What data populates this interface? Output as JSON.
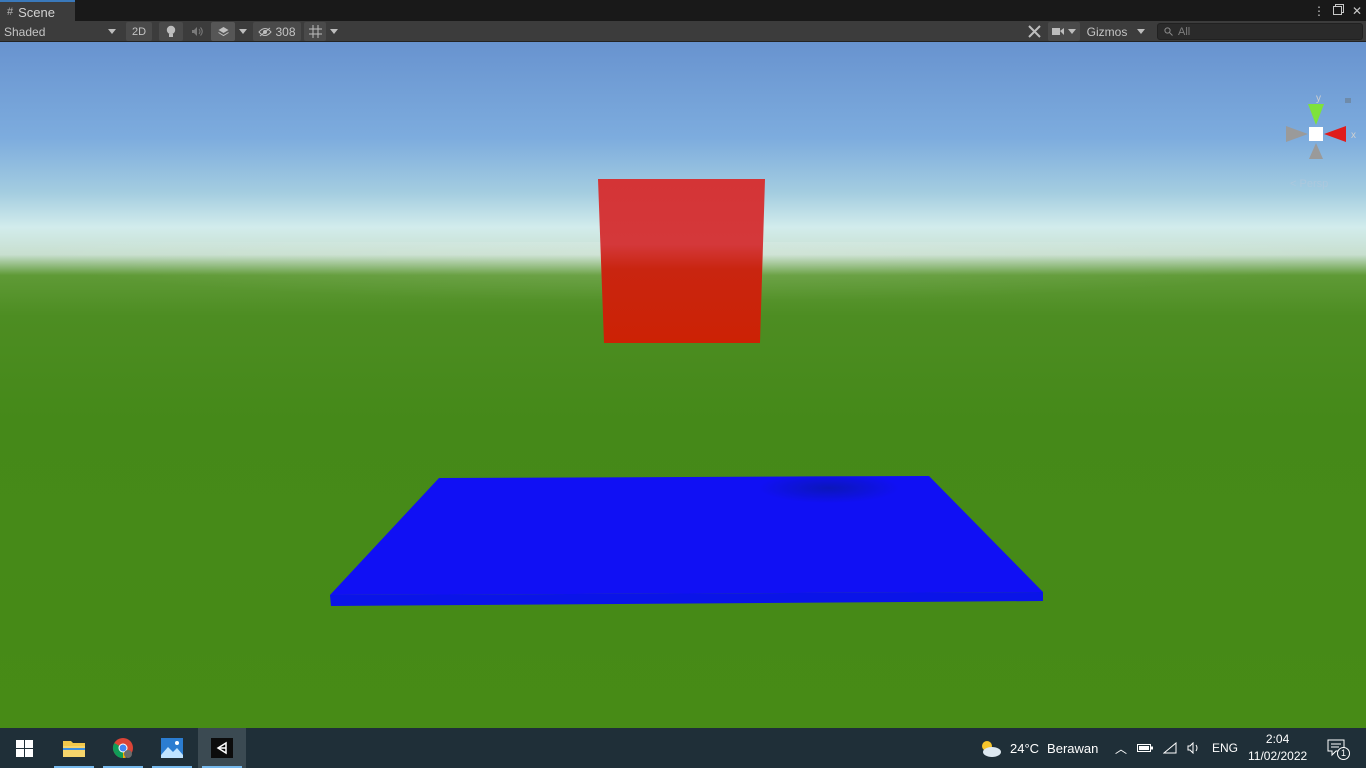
{
  "tab": {
    "icon": "hash-icon",
    "label": "Scene"
  },
  "window_controls": {
    "menu": "⋮",
    "maximize": "🗖",
    "close": "✕"
  },
  "toolbar": {
    "draw_mode": "Shaded",
    "mode_2d": "2D",
    "hidden_count": "308",
    "gizmos": "Gizmos",
    "search_placeholder": "All"
  },
  "gizmo": {
    "y_label": "y",
    "x_label": "x",
    "projection": "Persp"
  },
  "scene": {
    "sky_color": "#7daedd",
    "ground_color": "#478b16",
    "cube_color": "#cc2a14",
    "plane_color": "#0e14f2"
  },
  "taskbar": {
    "weather_temp": "24°C",
    "weather_desc": "Berawan",
    "language": "ENG",
    "time": "2:04",
    "date": "11/02/2022",
    "notification_count": "1"
  }
}
